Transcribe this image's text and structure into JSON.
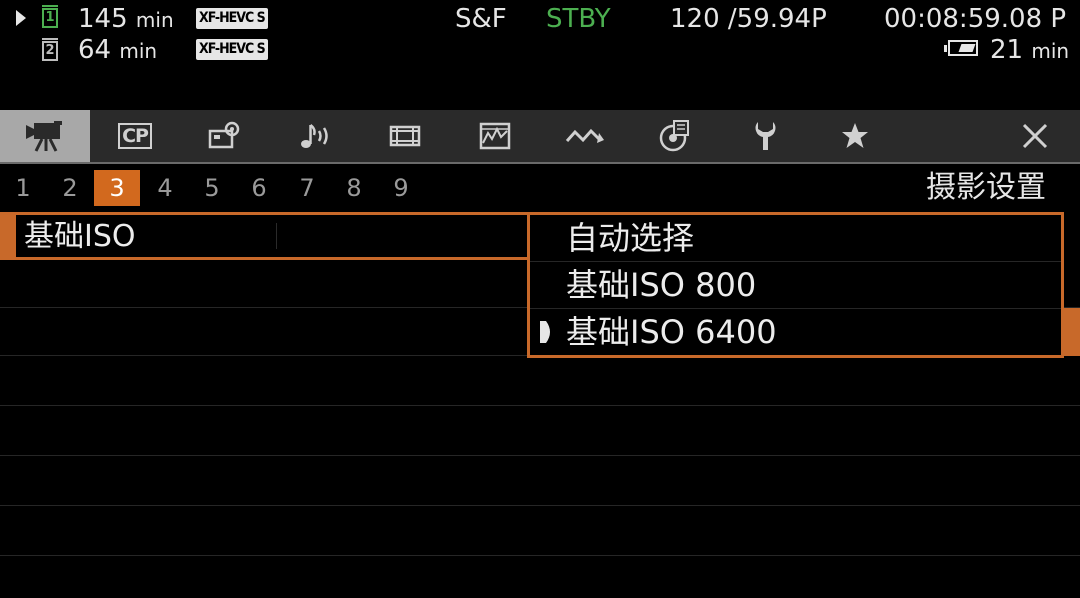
{
  "status": {
    "slot1": {
      "number": "1",
      "time_value": "145",
      "time_unit": "min",
      "codec": "XF-HEVC S"
    },
    "slot2": {
      "number": "2",
      "time_value": "64",
      "time_unit": "min",
      "codec": "XF-HEVC S"
    },
    "mode": "S&F",
    "state": "STBY",
    "frame_rate": "120 /59.94P",
    "timecode": "00:08:59.08 P",
    "battery_value": "21",
    "battery_unit": "min"
  },
  "colors": {
    "accent": "#c8692a",
    "active_page": "#d2691e",
    "slot_active": "#4caf50",
    "state_stby": "#4caf50"
  },
  "tabs": [
    {
      "icon": "camera-movie-icon",
      "active": true
    },
    {
      "icon": "cp-icon",
      "label": "CP",
      "active": false
    },
    {
      "icon": "camera-settings-icon",
      "active": false
    },
    {
      "icon": "audio-icon",
      "active": false
    },
    {
      "icon": "video-setup-icon",
      "active": false
    },
    {
      "icon": "assistance-display-icon",
      "active": false
    },
    {
      "icon": "network-icon",
      "active": false
    },
    {
      "icon": "recording-media-icon",
      "active": false
    },
    {
      "icon": "wrench-icon",
      "active": false
    },
    {
      "icon": "star-icon",
      "active": false
    },
    {
      "icon": "close-icon",
      "active": false
    }
  ],
  "pages": [
    "1",
    "2",
    "3",
    "4",
    "5",
    "6",
    "7",
    "8",
    "9"
  ],
  "active_page": "3",
  "page_title": "摄影设置",
  "menu": {
    "selected_item": "基础ISO"
  },
  "dropdown": {
    "options": [
      {
        "label": "自动选择",
        "current": false
      },
      {
        "label": "基础ISO 800",
        "current": false
      },
      {
        "label": "基础ISO 6400",
        "current": true
      }
    ]
  }
}
